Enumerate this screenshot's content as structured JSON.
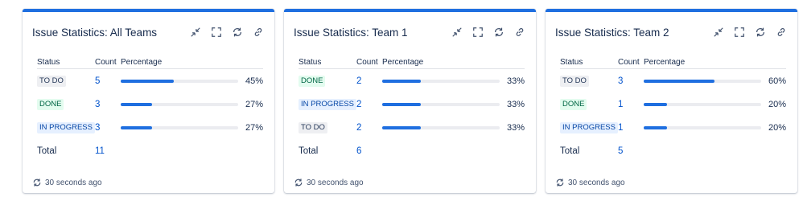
{
  "colors": {
    "accent": "#1f6fe0",
    "link": "#0052cc",
    "bar_track": "#ebecf0"
  },
  "icons": [
    "collapse-icon",
    "fullscreen-icon",
    "refresh-icon",
    "link-icon"
  ],
  "headers": {
    "status": "Status",
    "count": "Count",
    "percentage": "Percentage"
  },
  "total_label": "Total",
  "footer_text": "30 seconds ago",
  "gadgets": [
    {
      "title": "Issue Statistics: All Teams",
      "rows": [
        {
          "status": "TO DO",
          "type": "todo",
          "count": "5",
          "pct": "45%",
          "fraction": 0.45
        },
        {
          "status": "DONE",
          "type": "done",
          "count": "3",
          "pct": "27%",
          "fraction": 0.27
        },
        {
          "status": "IN PROGRESS",
          "type": "prog",
          "count": "3",
          "pct": "27%",
          "fraction": 0.27
        }
      ],
      "total": "11"
    },
    {
      "title": "Issue Statistics: Team 1",
      "rows": [
        {
          "status": "DONE",
          "type": "done",
          "count": "2",
          "pct": "33%",
          "fraction": 0.33
        },
        {
          "status": "IN PROGRESS",
          "type": "prog",
          "count": "2",
          "pct": "33%",
          "fraction": 0.33
        },
        {
          "status": "TO DO",
          "type": "todo",
          "count": "2",
          "pct": "33%",
          "fraction": 0.33
        }
      ],
      "total": "6"
    },
    {
      "title": "Issue Statistics: Team 2",
      "rows": [
        {
          "status": "TO DO",
          "type": "todo",
          "count": "3",
          "pct": "60%",
          "fraction": 0.6
        },
        {
          "status": "DONE",
          "type": "done",
          "count": "1",
          "pct": "20%",
          "fraction": 0.2
        },
        {
          "status": "IN PROGRESS",
          "type": "prog",
          "count": "1",
          "pct": "20%",
          "fraction": 0.2
        }
      ],
      "total": "5"
    }
  ]
}
